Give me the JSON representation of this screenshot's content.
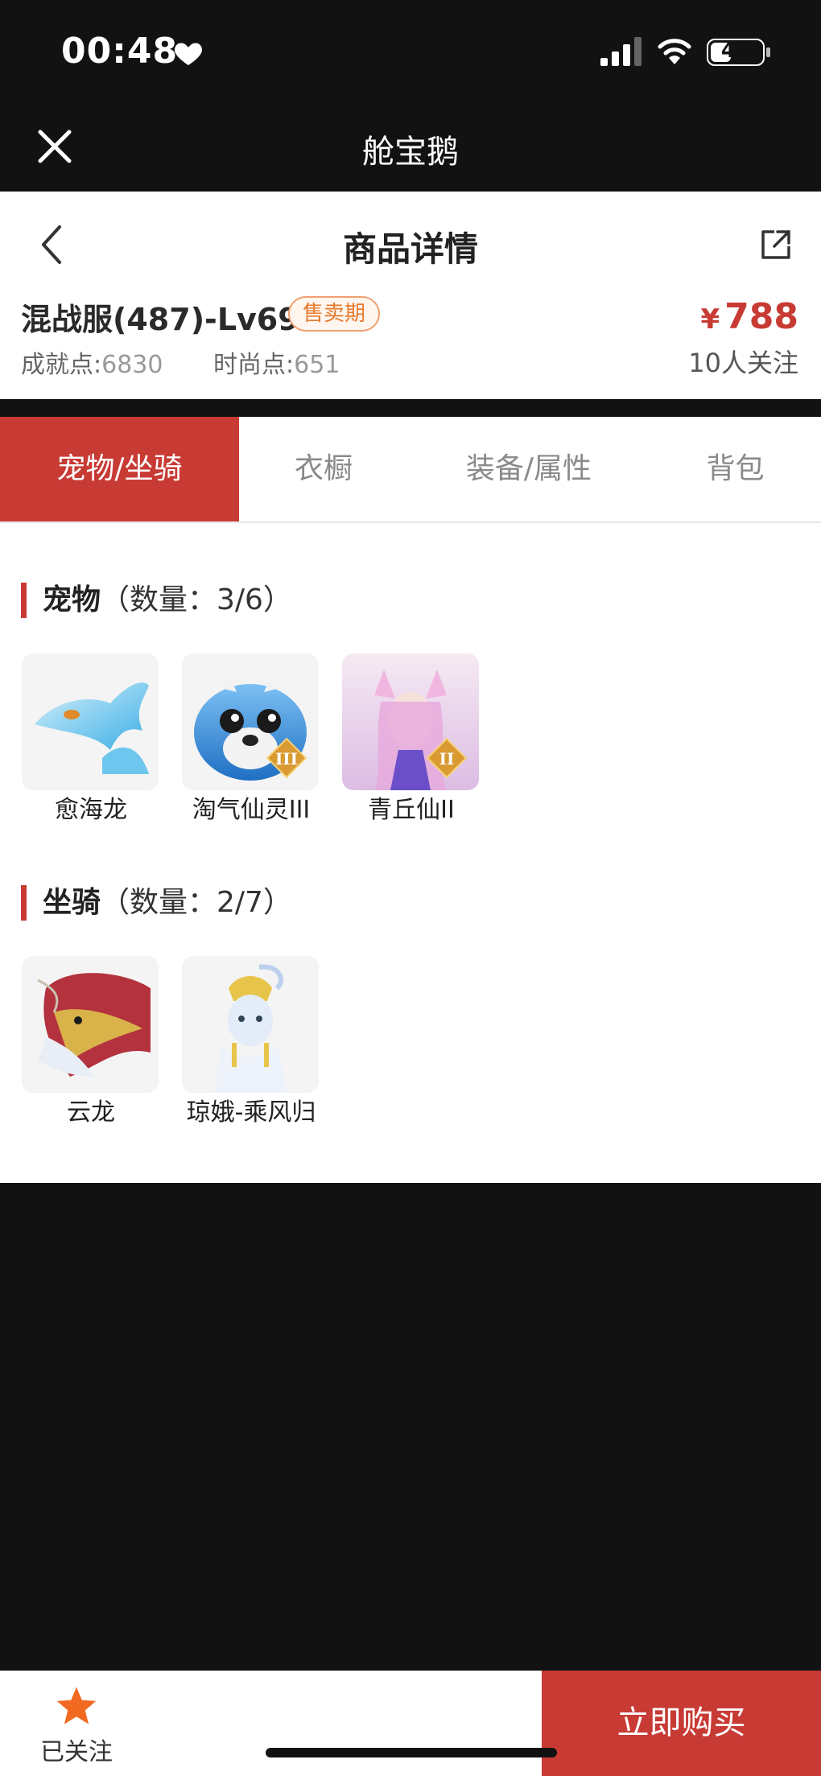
{
  "status": {
    "time": "00:48",
    "battery": "41",
    "battery_level": 0.41
  },
  "app": {
    "title": "舱宝鹅"
  },
  "header": {
    "title": "商品详情"
  },
  "product": {
    "name": "混战服(487)-Lv69",
    "badge": "售卖期",
    "achievement_label": "成就点:",
    "achievement_value": "6830",
    "fashion_label": "时尚点:",
    "fashion_value": "651",
    "currency": "¥",
    "price": "788",
    "followers": "10人关注"
  },
  "tabs": [
    {
      "label": "宠物/坐骑",
      "active": true
    },
    {
      "label": "衣橱",
      "active": false
    },
    {
      "label": "装备/属性",
      "active": false
    },
    {
      "label": "背包",
      "active": false
    }
  ],
  "pets": {
    "title": "宠物",
    "count": "（数量：3/6）",
    "items": [
      {
        "label": "愈海龙",
        "tier": "",
        "colors": [
          "#cfeaf7",
          "#48b4e6"
        ]
      },
      {
        "label": "淘气仙灵III",
        "tier": "III",
        "colors": [
          "#9fd0f5",
          "#2f7fd0"
        ]
      },
      {
        "label": "青丘仙II",
        "tier": "II",
        "colors": [
          "#f4d6ec",
          "#c98bd2"
        ]
      }
    ]
  },
  "mounts": {
    "title": "坐骑",
    "count": "（数量：2/7）",
    "items": [
      {
        "label": "云龙",
        "colors": [
          "#e8d3c0",
          "#b4353f"
        ]
      },
      {
        "label": "琼娥-乘风归",
        "colors": [
          "#eef2fa",
          "#b8c8e6"
        ]
      }
    ]
  },
  "bottom": {
    "follow_label": "已关注",
    "buy_label": "立即购买"
  },
  "colors": {
    "accent": "#c83a34",
    "badge": "#e67a2e",
    "star": "#f26a22"
  }
}
